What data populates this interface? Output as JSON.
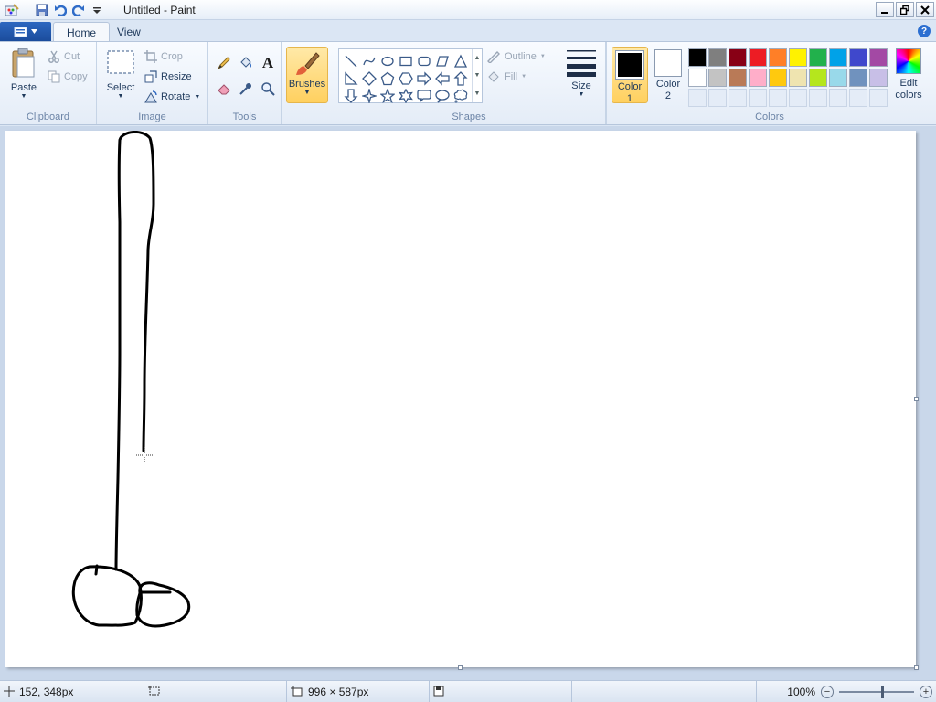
{
  "window": {
    "title": "Untitled - Paint"
  },
  "tabs": [
    {
      "label": "Home",
      "active": true
    },
    {
      "label": "View",
      "active": false
    }
  ],
  "clipboard": {
    "group_label": "Clipboard",
    "paste": "Paste",
    "cut": "Cut",
    "copy": "Copy"
  },
  "image": {
    "group_label": "Image",
    "select": "Select",
    "crop": "Crop",
    "resize": "Resize",
    "rotate": "Rotate"
  },
  "tools": {
    "group_label": "Tools"
  },
  "brushes": {
    "label": "Brushes"
  },
  "shapes": {
    "group_label": "Shapes",
    "outline": "Outline",
    "fill": "Fill",
    "icons": [
      "line-shape-icon",
      "curve-shape-icon",
      "oval-shape-icon",
      "rectangle-shape-icon",
      "rounded-rectangle-shape-icon",
      "polygon-shape-icon",
      "triangle-shape-icon",
      "right-triangle-shape-icon",
      "diamond-shape-icon",
      "pentagon-shape-icon",
      "hexagon-shape-icon",
      "right-arrow-shape-icon",
      "left-arrow-shape-icon",
      "up-arrow-shape-icon",
      "down-arrow-shape-icon",
      "four-point-star-shape-icon",
      "five-point-star-shape-icon",
      "six-point-star-shape-icon",
      "rounded-callout-shape-icon",
      "oval-callout-shape-icon",
      "cloud-callout-shape-icon"
    ]
  },
  "size": {
    "label": "Size"
  },
  "colors": {
    "group_label": "Colors",
    "color1": {
      "label": "Color\n1",
      "value": "#000000"
    },
    "color2": {
      "label": "Color\n2",
      "value": "#ffffff"
    },
    "edit": "Edit\ncolors",
    "palette": [
      "#000000",
      "#7f7f7f",
      "#880015",
      "#ed1c24",
      "#ff7f27",
      "#fff200",
      "#22b14c",
      "#00a2e8",
      "#3f48cc",
      "#a349a4",
      "#ffffff",
      "#c3c3c3",
      "#b97a57",
      "#ffaec9",
      "#ffc90e",
      "#efe4b0",
      "#b5e61d",
      "#99d9ea",
      "#7092be",
      "#c8bfe7",
      "",
      "",
      "",
      "",
      "",
      "",
      "",
      "",
      "",
      ""
    ]
  },
  "status": {
    "cursor_pos": "152, 348px",
    "selection_size": "",
    "canvas_size": "996 × 587px",
    "zoom": "100%",
    "zoom_level": 1.0
  }
}
